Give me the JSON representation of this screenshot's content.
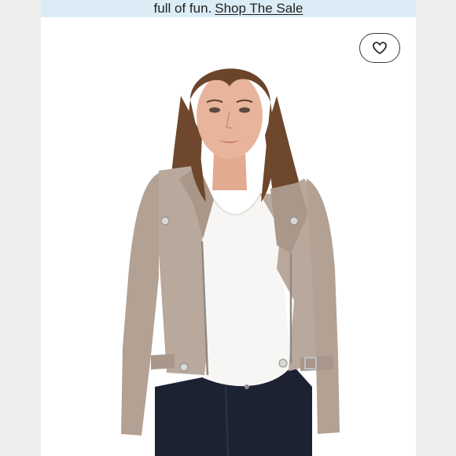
{
  "promo_banner": {
    "lead_text": "full of fun.",
    "link_text": "Shop The Sale"
  },
  "listing": {
    "image_alt": "Woman wearing a taupe suede moto jacket over a white tee and dark jeans",
    "like_icon": "heart-icon"
  },
  "colors": {
    "banner_bg": "#dcecf6",
    "page_bg": "#eeeeef",
    "jacket": "#b9a89c",
    "tee": "#f7f6f4",
    "denim": "#1d2233",
    "hair": "#6b4429",
    "skin": "#e8b59c"
  }
}
